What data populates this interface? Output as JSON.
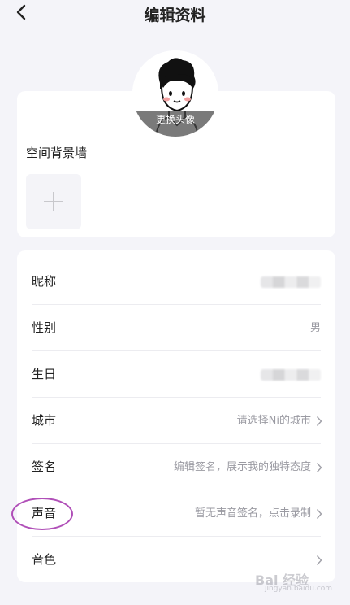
{
  "header": {
    "title": "编辑资料",
    "back_icon": "chevron-left-icon"
  },
  "avatar": {
    "change_label": "更换头像"
  },
  "background_wall": {
    "label": "空间背景墙",
    "add_icon": "plus-icon"
  },
  "profile_rows": [
    {
      "label": "昵称",
      "value": ""
    },
    {
      "label": "性别",
      "value": "男"
    },
    {
      "label": "生日",
      "value": ""
    },
    {
      "label": "城市",
      "value": "请选择Ni的城市"
    },
    {
      "label": "签名",
      "value": "编辑签名，展示我的独特态度"
    },
    {
      "label": "声音",
      "value": "暂无声音签名，点击录制"
    },
    {
      "label": "音色",
      "value": ""
    }
  ],
  "watermark": {
    "text": "Bai 经验",
    "sub": "jingyan.baidu.com"
  },
  "colors": {
    "background": "#f4f4f9",
    "annotation_circle": "#b04fb8",
    "secondary_text": "#9a9aa2"
  }
}
